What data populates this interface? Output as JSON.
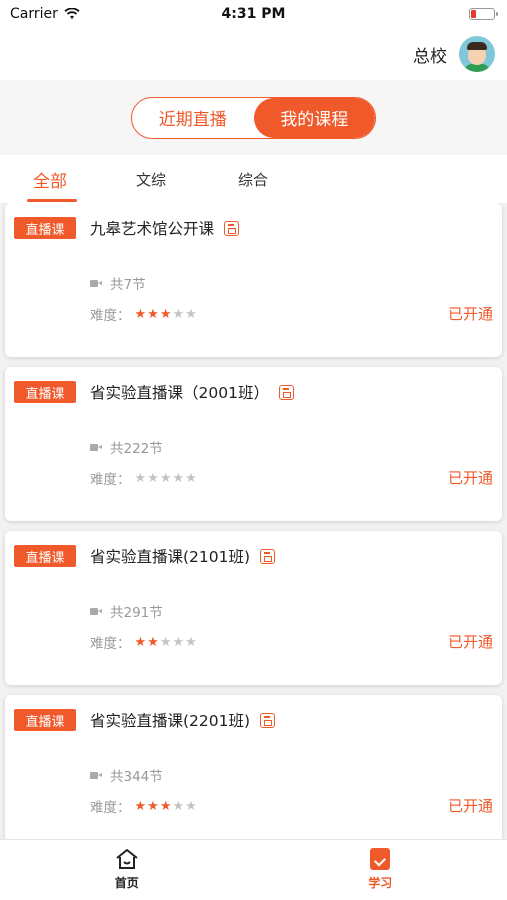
{
  "status_bar": {
    "carrier": "Carrier",
    "time": "4:31 PM"
  },
  "header": {
    "campus": "总校"
  },
  "segment": {
    "options": [
      "近期直播",
      "我的课程"
    ],
    "selected": "我的课程"
  },
  "category_tabs": [
    "全部",
    "文综",
    "综合"
  ],
  "courses": [
    {
      "badge": "直播课",
      "title": "九皋艺术馆公开课",
      "lessons": "共7节",
      "difficulty_label": "难度：",
      "difficulty": 3,
      "status": "已开通"
    },
    {
      "badge": "直播课",
      "title": "省实验直播课（2001班）",
      "lessons": "共222节",
      "difficulty_label": "难度：",
      "difficulty": 0,
      "status": "已开通"
    },
    {
      "badge": "直播课",
      "title": "省实验直播课(2101班)",
      "lessons": "共291节",
      "difficulty_label": "难度：",
      "difficulty": 2,
      "status": "已开通"
    },
    {
      "badge": "直播课",
      "title": "省实验直播课(2201班)",
      "lessons": "共344节",
      "difficulty_label": "难度：",
      "difficulty": 3,
      "status": "已开通"
    }
  ],
  "tab_bar": {
    "home": "首页",
    "study": "学习"
  },
  "colors": {
    "accent": "#f05a2b"
  }
}
